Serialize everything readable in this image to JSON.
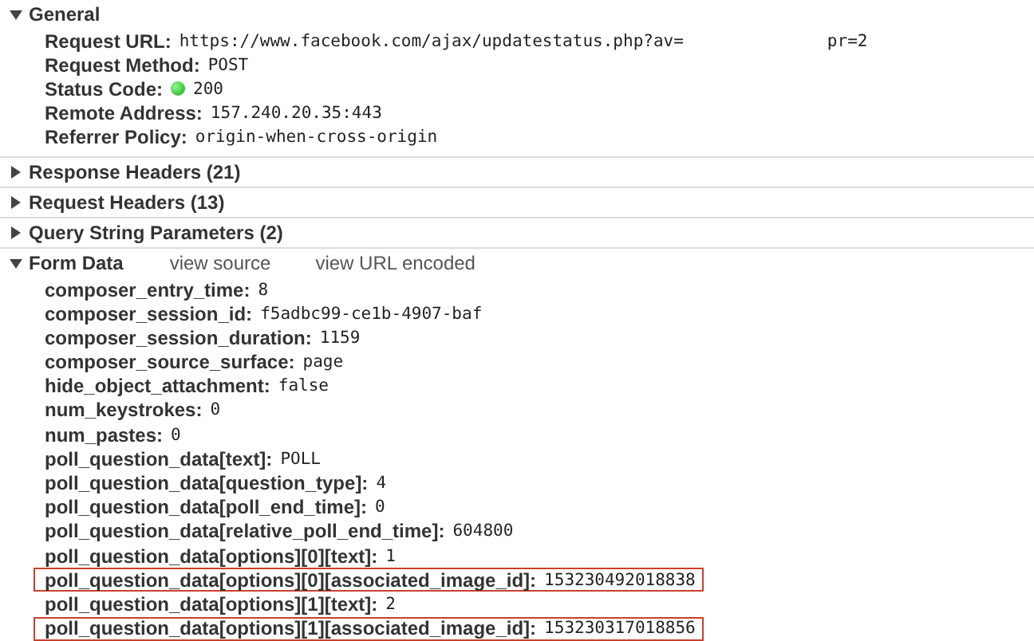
{
  "sections": [
    {
      "title": "General",
      "expanded": true,
      "rows": [
        {
          "kind": "plain",
          "name": "Request URL:",
          "value": "https://www.facebook.com/ajax/updatestatus.php?av=",
          "value_tail": "pr=2",
          "highlighted": false
        },
        {
          "kind": "plain",
          "name": "Request Method:",
          "value": "POST",
          "highlighted": false
        },
        {
          "kind": "status",
          "name": "Status Code:",
          "value": "200",
          "highlighted": false
        },
        {
          "kind": "plain",
          "name": "Remote Address:",
          "value": "157.240.20.35:443",
          "highlighted": false
        },
        {
          "kind": "plain",
          "name": "Referrer Policy:",
          "value": "origin-when-cross-origin",
          "highlighted": false
        }
      ]
    },
    {
      "title": "Response Headers (21)",
      "expanded": false
    },
    {
      "title": "Request Headers (13)",
      "expanded": false
    },
    {
      "title": "Query String Parameters (2)",
      "expanded": false
    },
    {
      "title": "Form Data",
      "expanded": true,
      "links": [
        "view source",
        "view URL encoded"
      ],
      "rows": [
        {
          "kind": "plain",
          "name": "composer_entry_time:",
          "value": "8",
          "highlighted": false
        },
        {
          "kind": "plain",
          "name": "composer_session_id:",
          "value": "f5adbc99-ce1b-4907-baf",
          "highlighted": false
        },
        {
          "kind": "plain",
          "name": "composer_session_duration:",
          "value": "1159",
          "highlighted": false
        },
        {
          "kind": "plain",
          "name": "composer_source_surface:",
          "value": "page",
          "highlighted": false
        },
        {
          "kind": "plain",
          "name": "hide_object_attachment:",
          "value": "false",
          "highlighted": false
        },
        {
          "kind": "plain",
          "name": "num_keystrokes:",
          "value": "0",
          "highlighted": false
        },
        {
          "kind": "plain",
          "name": "num_pastes:",
          "value": "0",
          "highlighted": false
        },
        {
          "kind": "plain",
          "name": "poll_question_data[text]:",
          "value": "POLL",
          "highlighted": false
        },
        {
          "kind": "plain",
          "name": "poll_question_data[question_type]:",
          "value": "4",
          "highlighted": false
        },
        {
          "kind": "plain",
          "name": "poll_question_data[poll_end_time]:",
          "value": "0",
          "highlighted": false
        },
        {
          "kind": "plain",
          "name": "poll_question_data[relative_poll_end_time]:",
          "value": "604800",
          "highlighted": false
        },
        {
          "kind": "plain",
          "name": "poll_question_data[options][0][text]:",
          "value": "1",
          "highlighted": false
        },
        {
          "kind": "plain",
          "name": "poll_question_data[options][0][associated_image_id]:",
          "value": "153230492018838",
          "highlighted": true
        },
        {
          "kind": "plain",
          "name": "poll_question_data[options][1][text]:",
          "value": "2",
          "highlighted": false
        },
        {
          "kind": "plain",
          "name": "poll_question_data[options][1][associated_image_id]:",
          "value": "153230317018856",
          "highlighted": true
        }
      ]
    }
  ]
}
